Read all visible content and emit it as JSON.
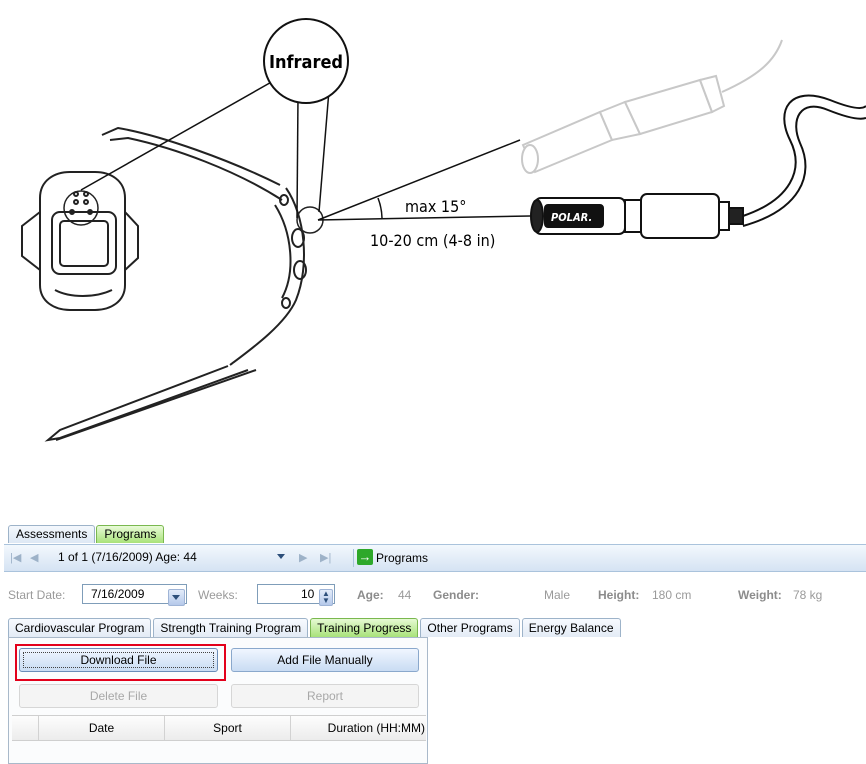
{
  "illustration": {
    "callout_label": "Infrared",
    "angle_label": "max 15°",
    "distance_label": "10-20 cm (4-8 in)",
    "brand_logo": "POLAR."
  },
  "app": {
    "top_tabs": [
      "Assessments",
      "Programs"
    ],
    "active_top_tab": "Programs",
    "nav": {
      "record_selector": "1 of 1 (7/16/2009) Age: 44",
      "programs_button": "Programs",
      "icons": [
        "first-icon",
        "prev-icon",
        "next-icon",
        "last-icon",
        "go-arrow-icon"
      ]
    },
    "info": {
      "start_date_label": "Start Date:",
      "start_date_value": "7/16/2009",
      "weeks_label": "Weeks:",
      "weeks_value": "10",
      "age_label": "Age:",
      "age_value": "44",
      "gender_label": "Gender:",
      "gender_value": "Male",
      "height_label": "Height:",
      "height_value": "180 cm",
      "weight_label": "Weight:",
      "weight_value": "78 kg"
    },
    "sub_tabs": [
      "Cardiovascular Program",
      "Strength Training Program",
      "Training Progress",
      "Other Programs",
      "Energy Balance"
    ],
    "active_sub_tab": "Training Progress",
    "buttons": {
      "download": "Download File",
      "add_manual": "Add File Manually",
      "delete": "Delete File",
      "report": "Report"
    },
    "grid_columns": [
      "Date",
      "Sport",
      "Duration (HH:MM)"
    ],
    "colors": {
      "active_tab": "#a8e27a",
      "highlight": "#e3001b",
      "toolbar": "#d5e3f3"
    }
  }
}
